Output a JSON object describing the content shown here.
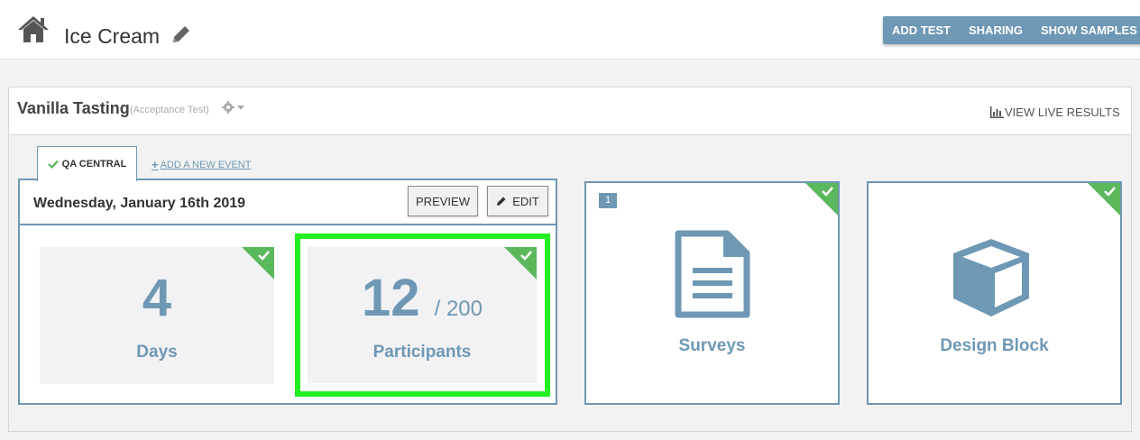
{
  "header": {
    "title": "Ice Cream",
    "buttons": [
      "ADD TEST",
      "SHARING",
      "SHOW SAMPLES"
    ]
  },
  "test": {
    "name": "Vanilla Tasting",
    "type": "(Acceptance Test)",
    "view_live_results": "VIEW LIVE RESULTS"
  },
  "tabs": {
    "active": "QA CENTRAL",
    "add_event": "ADD A NEW EVENT"
  },
  "event": {
    "date": "Wednesday, January 16th 2019",
    "preview_label": "PREVIEW",
    "edit_label": "EDIT",
    "days": {
      "value": "4",
      "label": "Days",
      "complete": true
    },
    "participants": {
      "value": "12",
      "of": "/ 200",
      "label": "Participants",
      "complete": true,
      "highlighted": true
    }
  },
  "cards": {
    "surveys": {
      "label": "Surveys",
      "count": "1",
      "complete": true
    },
    "design_block": {
      "label": "Design Block",
      "complete": true
    }
  },
  "colors": {
    "accent": "#6e98b4",
    "check_green": "#5cb85c",
    "highlight": "#22ee22",
    "icon_dark": "#555555"
  },
  "icons": [
    "home-icon",
    "pencil-icon",
    "gear-icon",
    "bar-chart-icon",
    "check-icon",
    "plus-icon",
    "document-icon",
    "cube-icon"
  ]
}
